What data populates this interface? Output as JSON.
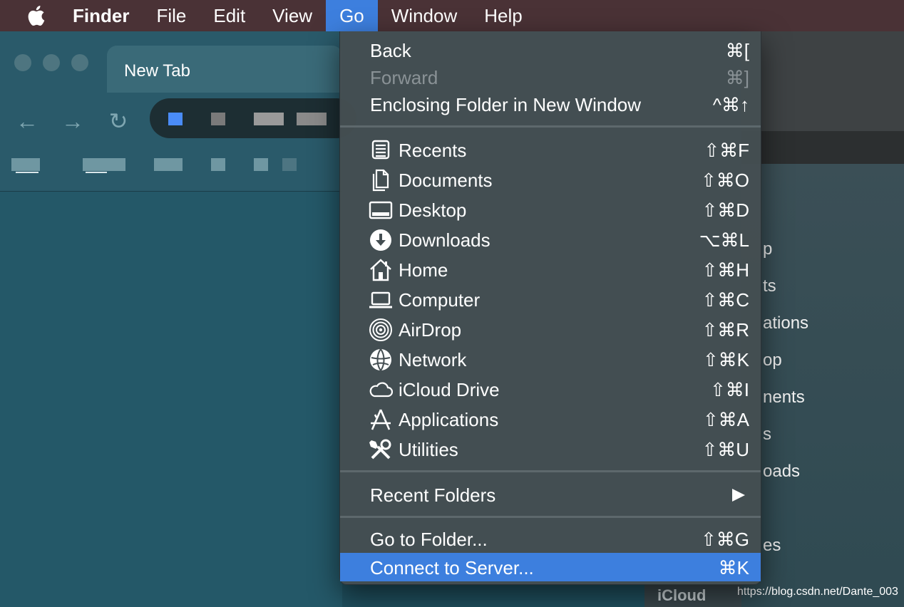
{
  "menubar": {
    "apple_icon": "apple-logo-icon",
    "app_name": "Finder",
    "items": [
      "File",
      "Edit",
      "View",
      "Go",
      "Window",
      "Help"
    ],
    "active": "Go"
  },
  "browser": {
    "tab_title": "New Tab"
  },
  "go_menu": {
    "back": {
      "label": "Back",
      "shortcut": "⌘["
    },
    "forward": {
      "label": "Forward",
      "shortcut": "⌘]"
    },
    "enclosing": {
      "label": "Enclosing Folder in New Window",
      "shortcut": "^⌘↑"
    },
    "places": [
      {
        "label": "Recents",
        "shortcut": "⇧⌘F",
        "icon": "recents-icon"
      },
      {
        "label": "Documents",
        "shortcut": "⇧⌘O",
        "icon": "documents-icon"
      },
      {
        "label": "Desktop",
        "shortcut": "⇧⌘D",
        "icon": "desktop-icon"
      },
      {
        "label": "Downloads",
        "shortcut": "⌥⌘L",
        "icon": "downloads-icon"
      },
      {
        "label": "Home",
        "shortcut": "⇧⌘H",
        "icon": "home-icon"
      },
      {
        "label": "Computer",
        "shortcut": "⇧⌘C",
        "icon": "computer-icon"
      },
      {
        "label": "AirDrop",
        "shortcut": "⇧⌘R",
        "icon": "airdrop-icon"
      },
      {
        "label": "Network",
        "shortcut": "⇧⌘K",
        "icon": "network-icon"
      },
      {
        "label": "iCloud Drive",
        "shortcut": "⇧⌘I",
        "icon": "icloud-icon"
      },
      {
        "label": "Applications",
        "shortcut": "⇧⌘A",
        "icon": "applications-icon"
      },
      {
        "label": "Utilities",
        "shortcut": "⇧⌘U",
        "icon": "utilities-icon"
      }
    ],
    "recent_folders": {
      "label": "Recent Folders"
    },
    "go_to_folder": {
      "label": "Go to Folder...",
      "shortcut": "⇧⌘G"
    },
    "connect_to_server": {
      "label": "Connect to Server...",
      "shortcut": "⌘K"
    }
  },
  "finder_sidebar": {
    "partial_items": [
      "p",
      "ts",
      "ations",
      "op",
      "nents",
      "s",
      "oads",
      "es"
    ],
    "icloud_header": "iCloud"
  },
  "watermark": "https://blog.csdn.net/Dante_003",
  "colors": {
    "menubar": "#4a3236",
    "highlight": "#3d7fde",
    "menu_bg": "#444e52",
    "desktop": "#245868"
  }
}
